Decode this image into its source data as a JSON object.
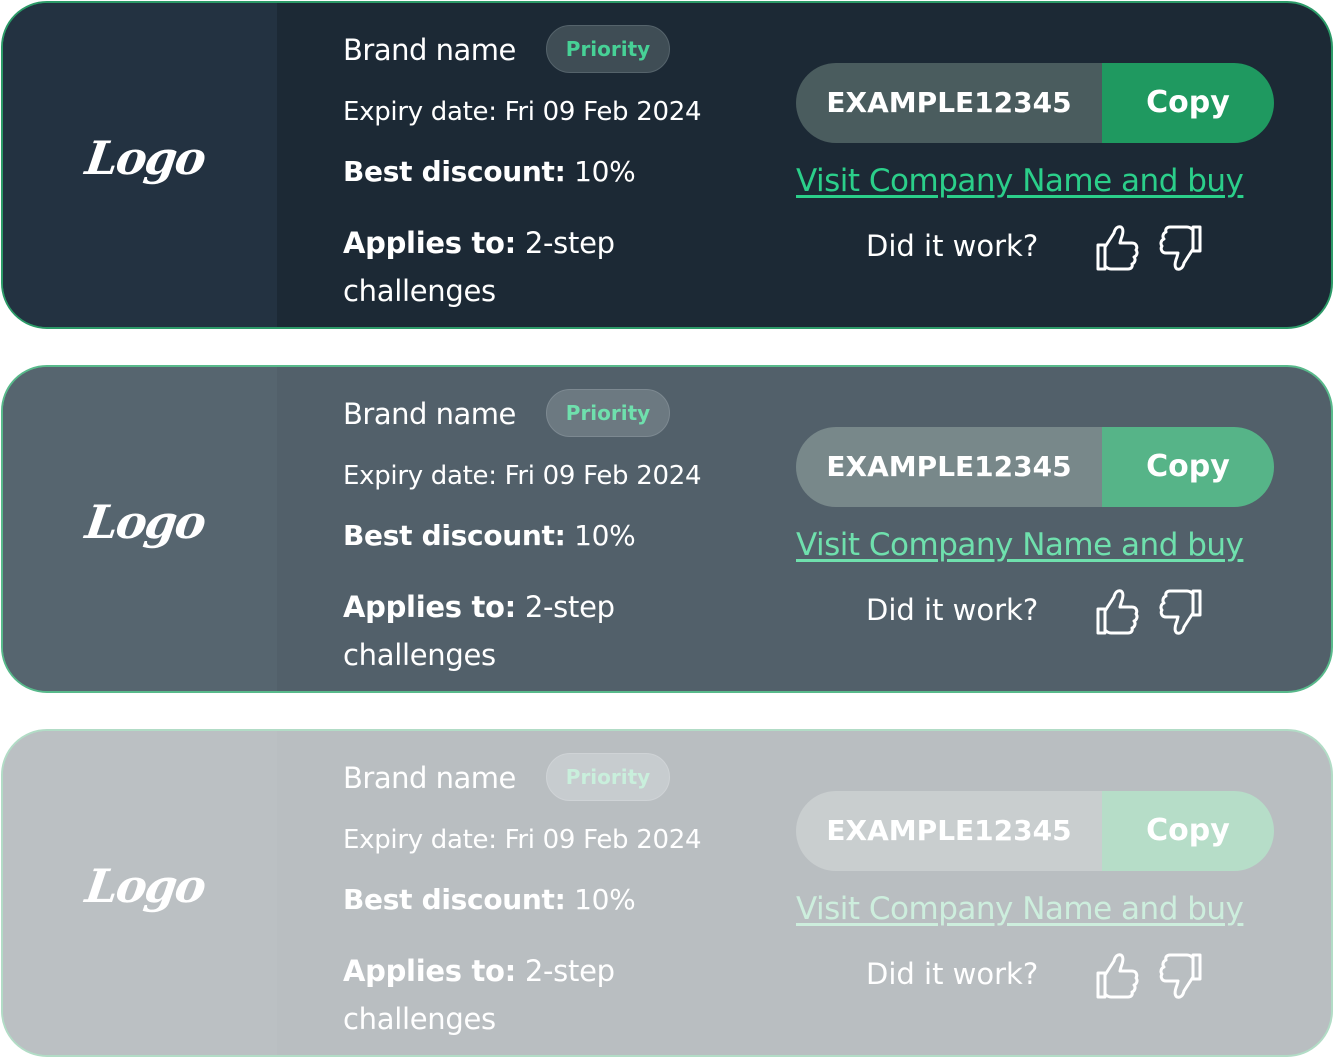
{
  "cards": [
    {
      "logo": "Logo",
      "brand": "Brand name",
      "badge": "Priority",
      "expiry": "Expiry date: Fri 09 Feb 2024",
      "discount_label": "Best discount:",
      "discount_value": " 10%",
      "applies_label": "Applies to:",
      "applies_value": " 2-step challenges",
      "code": "EXAMPLE12345",
      "copy_label": "Copy",
      "visit_link": "Visit Company Name and buy",
      "feedback_prompt": "Did it work?"
    },
    {
      "logo": "Logo",
      "brand": "Brand name",
      "badge": "Priority",
      "expiry": "Expiry date: Fri 09 Feb 2024",
      "discount_label": "Best discount:",
      "discount_value": " 10%",
      "applies_label": "Applies to:",
      "applies_value": " 2-step challenges",
      "code": "EXAMPLE12345",
      "copy_label": "Copy",
      "visit_link": "Visit Company Name and buy",
      "feedback_prompt": "Did it work?"
    },
    {
      "logo": "Logo",
      "brand": "Brand name",
      "badge": "Priority",
      "expiry": "Expiry date: Fri 09 Feb 2024",
      "discount_label": "Best discount:",
      "discount_value": " 10%",
      "applies_label": "Applies to:",
      "applies_value": " 2-step challenges",
      "code": "EXAMPLE12345",
      "copy_label": "Copy",
      "visit_link": "Visit Company Name and buy",
      "feedback_prompt": "Did it work?"
    }
  ],
  "icons": {
    "feedback_up": "thumbs-up-icon",
    "feedback_down": "thumbs-down-icon"
  },
  "colors": {
    "primary_green": "#1f9960",
    "link_green": "#2bcf8a",
    "card_dark": "#1c2935"
  }
}
